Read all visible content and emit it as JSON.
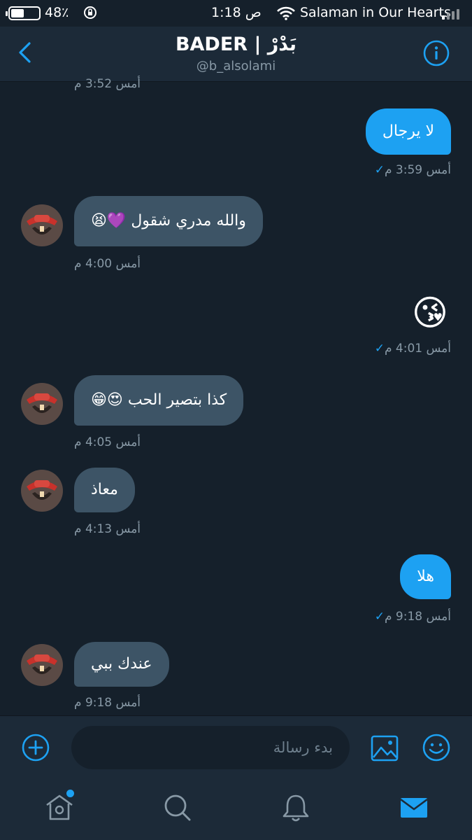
{
  "status_bar": {
    "battery_percent": "48٪",
    "battery_level": 0.48,
    "time": "1:18 ص",
    "carrier": "Salaman in Our Hearts"
  },
  "header": {
    "title": "BADER | بَدْرْ",
    "handle": "@b_alsolami",
    "back_icon": "chevron-left-icon",
    "info_icon": "info-icon"
  },
  "conversation": {
    "top_partial_timestamp": "أمس 3:52 م",
    "messages": [
      {
        "direction": "out",
        "text": "لا يرجال",
        "timestamp": "أمس 3:59 م",
        "read": true
      },
      {
        "direction": "in",
        "text": "والله مدري شقول 💜😫",
        "timestamp": "أمس 4:00 م"
      },
      {
        "direction": "out",
        "text": "😘",
        "timestamp": "أمس 4:01 م",
        "read": true
      },
      {
        "direction": "in",
        "text": "كذا بتصير الحب 😍😁",
        "timestamp": "أمس 4:05 م"
      },
      {
        "direction": "in",
        "text": "معاذ",
        "timestamp": "أمس 4:13 م"
      },
      {
        "direction": "out",
        "text": "هلا",
        "timestamp": "أمس 9:18 م",
        "read": true
      },
      {
        "direction": "in",
        "text": "عندك ببي",
        "timestamp": "أمس 9:18 م"
      }
    ]
  },
  "composer": {
    "placeholder": "بدء رسالة",
    "value": "",
    "add_icon": "plus-circle-icon",
    "media_icon": "image-icon",
    "gif_icon": "smiley-icon"
  },
  "tabbar": {
    "items": [
      "home-icon",
      "search-icon",
      "bell-icon",
      "mail-icon"
    ],
    "active": "mail-icon",
    "home_has_notification": true
  },
  "colors": {
    "background": "#15202b",
    "bar": "#1c2a38",
    "accent": "#1da1f2",
    "incoming_bubble": "#3d5466",
    "secondary_text": "#8899a6"
  }
}
